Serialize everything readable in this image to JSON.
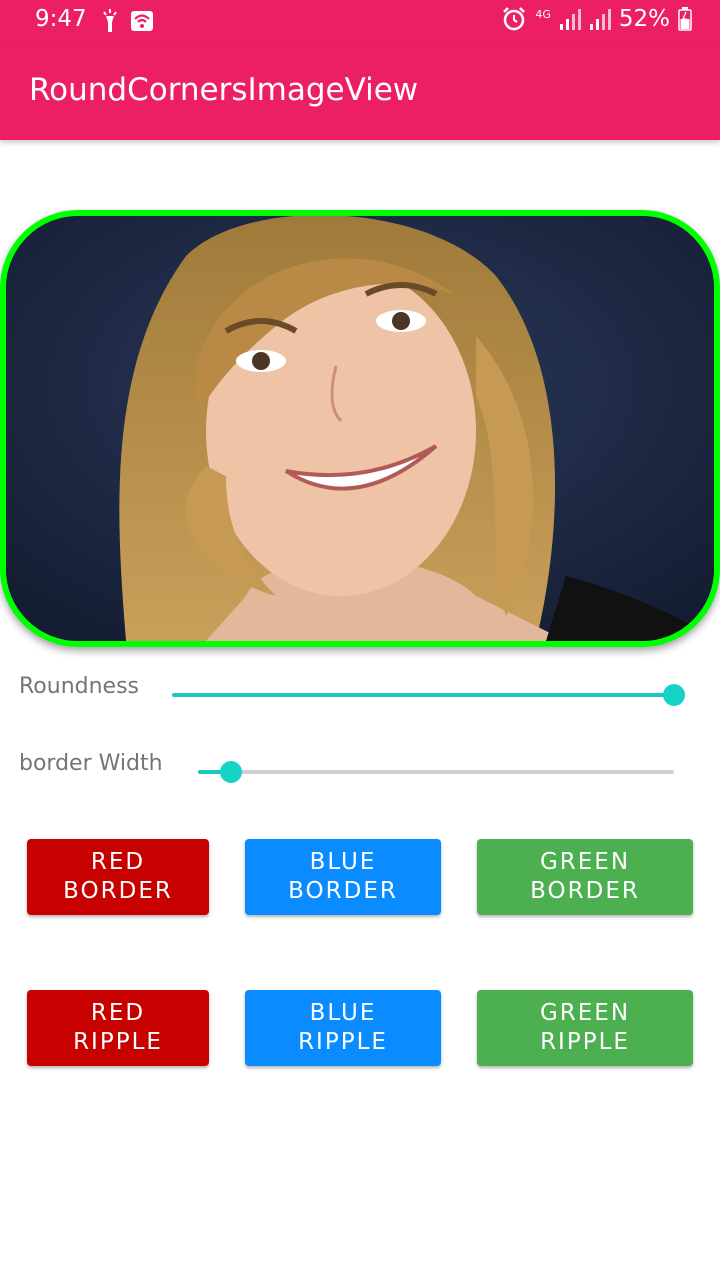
{
  "status_bar": {
    "time": "9:47",
    "battery": "52%",
    "network": "4G",
    "icons_left": [
      "flashlight-icon",
      "wifi-icon"
    ],
    "icons_right": [
      "alarm-icon",
      "signal-icon",
      "signal-icon",
      "battery-icon"
    ]
  },
  "app_bar": {
    "title": "RoundCornersImageView"
  },
  "colors": {
    "primary": "#EC1F66",
    "image_border": "#00FF00",
    "accent": "#16D3C8",
    "red": "#C70000",
    "blue": "#0A8BFF",
    "green": "#4CAF50"
  },
  "controls": {
    "roundness": {
      "label": "Roundness",
      "value_fraction": 1.0
    },
    "border_width": {
      "label": "border Width",
      "value_fraction": 0.07
    }
  },
  "buttons": {
    "red_border": {
      "line1": "RED",
      "line2": "BORDER"
    },
    "blue_border": {
      "line1": "BLUE",
      "line2": "BORDER"
    },
    "green_border": {
      "line1": "GREEN",
      "line2": "BORDER"
    },
    "red_ripple": {
      "line1": "RED",
      "line2": "RIPPLE"
    },
    "blue_ripple": {
      "line1": "BLUE",
      "line2": "RIPPLE"
    },
    "green_ripple": {
      "line1": "GREEN",
      "line2": "RIPPLE"
    }
  }
}
